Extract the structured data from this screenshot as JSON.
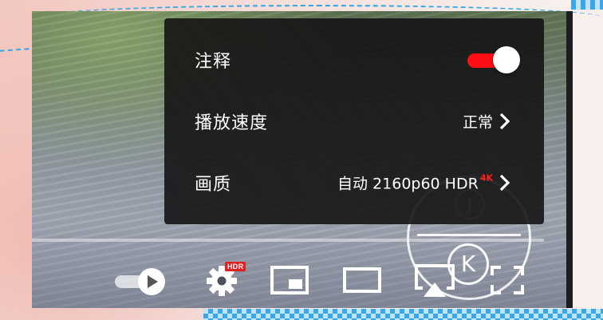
{
  "settings_menu": {
    "annotations": {
      "label": "注释",
      "enabled": true
    },
    "playback_speed": {
      "label": "播放速度",
      "value": "正常"
    },
    "quality": {
      "label": "画质",
      "value": "自动 2160p60 HDR",
      "badge": "4K"
    }
  },
  "controls": {
    "settings_badge": "HDR",
    "icons": [
      "autoplay-toggle-icon",
      "gear-icon",
      "miniplayer-icon",
      "theater-mode-icon",
      "airplay-icon",
      "fullscreen-icon"
    ]
  },
  "watermark": {
    "letters": [
      "J",
      "K"
    ]
  },
  "colors": {
    "accent_red": "#ff0e16",
    "badge_red": "#e02020",
    "panel_bg": "#141414"
  }
}
